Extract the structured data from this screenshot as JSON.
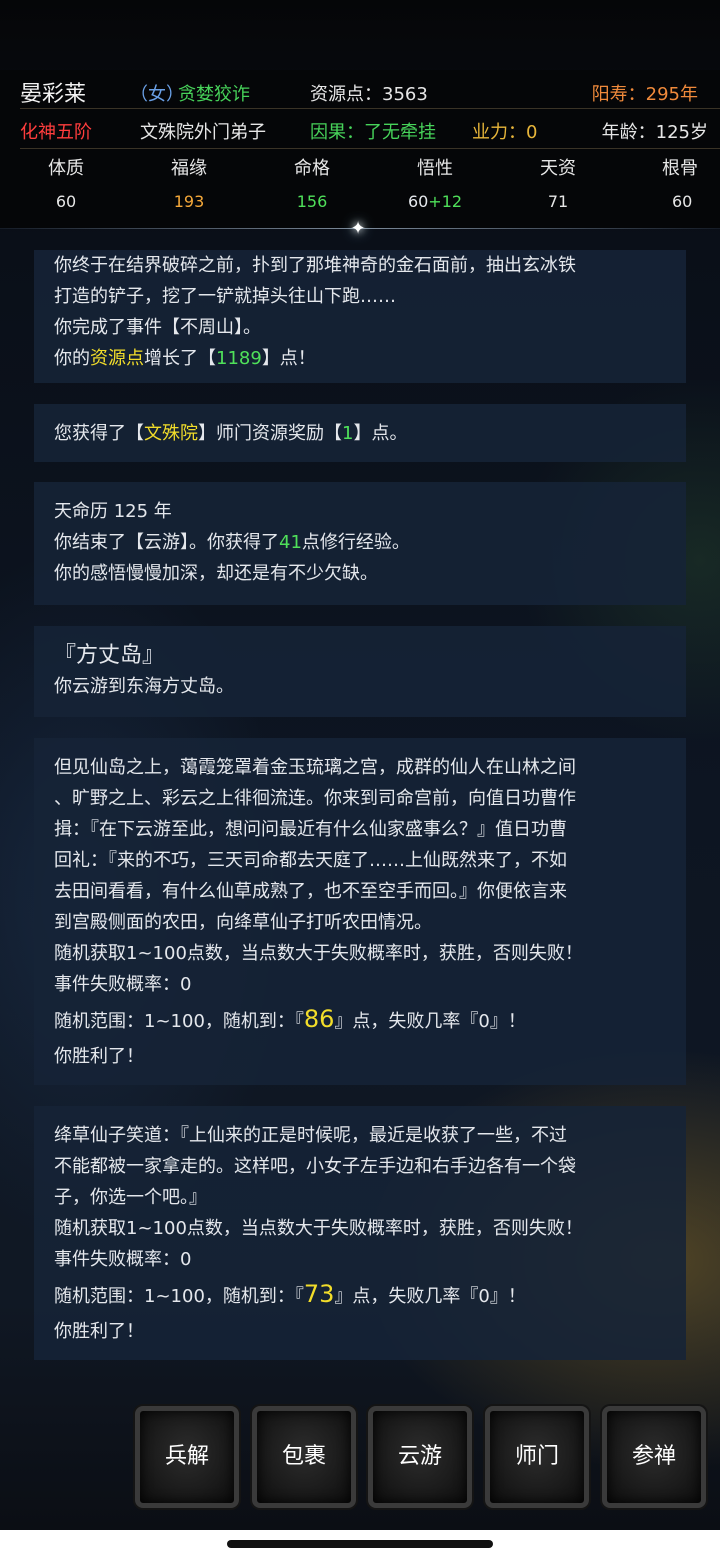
{
  "header": {
    "name": "晏彩莱",
    "gender": "（女）",
    "trait": "贪婪狡诈",
    "resources": "资源点：3563",
    "lifespan": "阳寿：295年",
    "realm": "化神五阶",
    "sect": "文殊院外门弟子",
    "karma": "因果：了无牵挂",
    "yeli": "业力：0",
    "age": "年龄：125岁"
  },
  "stats": [
    {
      "label": "体质",
      "value": "60",
      "color": "#e6e6e6"
    },
    {
      "label": "福缘",
      "value": "193",
      "color": "#f5a83a"
    },
    {
      "label": "命格",
      "value": "156",
      "color": "#4fe05a"
    },
    {
      "label": "悟性",
      "value": "60",
      "bonus": "+12",
      "color": "#e6e6e6"
    },
    {
      "label": "天资",
      "value": "71",
      "color": "#e6e6e6"
    },
    {
      "label": "根骨",
      "value": "60",
      "color": "#e6e6e6"
    }
  ],
  "log": {
    "c1": {
      "l1": "你终于在结界破碎之前，扑到了那堆神奇的金石面前，抽出玄冰铁",
      "l2": "打造的铲子，挖了一铲就掉头往山下跑……",
      "l3": "你完成了事件【不周山】。",
      "l4a": "你的",
      "l4b": "资源点",
      "l4c": "增长了【",
      "l4d": "1189",
      "l4e": "】点！"
    },
    "c2": {
      "a": "您获得了【",
      "b": "文殊院",
      "c": "】师门资源奖励【",
      "d": "1",
      "e": "】点。"
    },
    "c3": {
      "year": "天命历 125 年",
      "l1a": "你结束了【云游】。你获得了",
      "l1b": "41",
      "l1c": "点修行经验。",
      "l2": "你的感悟慢慢加深，却还是有不少欠缺。"
    },
    "c4": {
      "title": "『方丈岛』",
      "l1": "你云游到东海方丈岛。"
    },
    "c5": {
      "l1": "但见仙岛之上，蔼霞笼罩着金玉琉璃之宫，成群的仙人在山林之间",
      "l2": "、旷野之上、彩云之上徘徊流连。你来到司命宫前，向值日功曹作",
      "l3": "揖：『在下云游至此，想问问最近有什么仙家盛事么？』值日功曹",
      "l4": "回礼：『来的不巧，三天司命都去天庭了……上仙既然来了，不如",
      "l5": "去田间看看，有什么仙草成熟了，也不至空手而回。』你便依言来",
      "l6": "到宫殿侧面的农田，向绛草仙子打听农田情况。",
      "rule": "随机获取1~100点数，当点数大于失败概率时，获胜，否则失败！",
      "fail": "事件失败概率：0",
      "rangeA": "随机范围：1~100，随机到：『",
      "roll": "86",
      "rangeB": "』点，失败几率『0』！",
      "win": "你胜利了！"
    },
    "c6": {
      "l1": "绛草仙子笑道：『上仙来的正是时候呢，最近是收获了一些，不过",
      "l2": "不能都被一家拿走的。这样吧，小女子左手边和右手边各有一个袋",
      "l3": "子，你选一个吧。』",
      "rule": "随机获取1~100点数，当点数大于失败概率时，获胜，否则失败！",
      "fail": "事件失败概率：0",
      "rangeA": "随机范围：1~100，随机到：『",
      "roll": "73",
      "rangeB": "』点，失败几率『0』！",
      "win": "你胜利了！"
    }
  },
  "buttons": {
    "b1": "兵解",
    "b2": "包裹",
    "b3": "云游",
    "b4": "师门",
    "b5": "参禅"
  },
  "icons": {
    "sparkle": "sparkle-icon"
  }
}
